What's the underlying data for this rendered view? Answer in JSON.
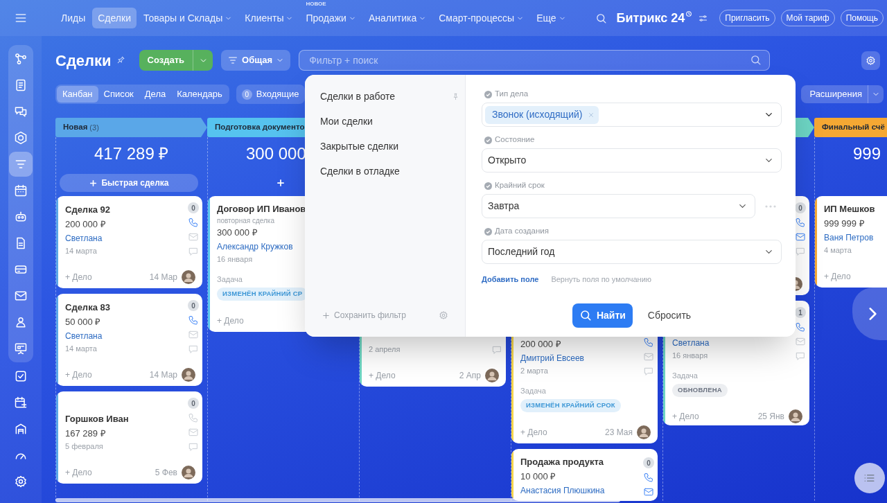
{
  "top_nav": {
    "items": [
      {
        "label": "Лиды",
        "selected": false,
        "dropdown": false
      },
      {
        "label": "Сделки",
        "selected": true,
        "dropdown": false
      },
      {
        "label": "Товары и Склады",
        "selected": false,
        "dropdown": true
      },
      {
        "label": "Клиенты",
        "selected": false,
        "dropdown": true
      },
      {
        "label": "Продажи",
        "selected": false,
        "dropdown": true,
        "badge": "НОВОЕ"
      },
      {
        "label": "Аналитика",
        "selected": false,
        "dropdown": true
      },
      {
        "label": "Смарт-процессы",
        "selected": false,
        "dropdown": true
      },
      {
        "label": "Еще",
        "selected": false,
        "dropdown": true
      }
    ],
    "logo": "Битрикс 24",
    "buttons": [
      "Пригласить",
      "Мой тариф",
      "Помощь"
    ]
  },
  "sidebar": {
    "panel_items": [
      {
        "selected": false
      },
      {
        "selected": false
      },
      {
        "selected": false
      },
      {
        "selected": false
      },
      {
        "selected": true
      },
      {
        "selected": false
      },
      {
        "selected": false
      },
      {
        "selected": false
      },
      {
        "selected": false
      },
      {
        "selected": false
      },
      {
        "selected": false
      },
      {
        "selected": false
      }
    ],
    "other_items": [
      {
        "selected": false
      },
      {
        "selected": false
      },
      {
        "selected": false
      },
      {
        "selected": false
      },
      {
        "selected": false
      }
    ]
  },
  "header": {
    "title": "Сделки",
    "create_button": "Создать",
    "category_button": "Общая",
    "search": {
      "placeholder": "Фильтр + поиск"
    }
  },
  "view_tabs": [
    {
      "label": "Канбан",
      "selected": true
    },
    {
      "label": "Список",
      "selected": false
    },
    {
      "label": "Дела",
      "selected": false
    },
    {
      "label": "Календарь",
      "selected": false
    }
  ],
  "incoming": {
    "count": "0",
    "label": "Входящие"
  },
  "extensions_button": "Расширения",
  "columns": [
    {
      "color": "#5aa7e8",
      "header": {
        "kind": "titled",
        "title": "Новая",
        "count": "(3)"
      },
      "amount": "417 289 ₽",
      "quick_add": {
        "kind": "wide",
        "label": "Быстрая сделка"
      },
      "cards": [
        {
          "title": "Сделка 92",
          "counter": "0",
          "amount": "200 000 ₽",
          "contact": "Светлана",
          "date": "14 марта",
          "icons": [
            {
              "kind": "phone",
              "active": true
            },
            {
              "kind": "mail",
              "active": false
            },
            {
              "kind": "chat",
              "active": false
            }
          ],
          "add_activity": "+ Дело",
          "due": "14 Мар",
          "avatar": true
        },
        {
          "title": "Сделка 83",
          "counter": "0",
          "amount": "50 000 ₽",
          "contact": "Светлана",
          "date": "14 марта",
          "icons": [
            {
              "kind": "phone",
              "active": true
            },
            {
              "kind": "mail",
              "active": false
            },
            {
              "kind": "chat",
              "active": false
            }
          ],
          "add_activity": "+ Дело",
          "due": "14 Мар",
          "avatar": true
        },
        {
          "title": "Горшков Иван",
          "counter": "0",
          "amount": "167 289 ₽",
          "date": "5 февраля",
          "icons": [
            {
              "kind": "phone",
              "active": false
            },
            {
              "kind": "mail",
              "active": false
            },
            {
              "kind": "chat",
              "active": false
            }
          ],
          "add_activity": "+ Дело",
          "due": "5 Фев",
          "avatar": true
        }
      ]
    },
    {
      "color": "#56c3ef",
      "header": {
        "kind": "titled",
        "title": "Подготовка документо"
      },
      "amount": "300 000",
      "quick_add": {
        "kind": "plus"
      },
      "cards": [
        {
          "title": "Договор ИП Иванов",
          "subtitle": "повторная сделка",
          "amount": "300 000 ₽",
          "contact": "Александр Кружков",
          "date": "16 января",
          "task": {
            "label": "Задача",
            "badge": "ИЗМЕНЁН КРАЙНИЙ СР",
            "kind": "changed"
          },
          "add_activity": "+ Дело"
        }
      ]
    },
    {
      "color": "#6dd5c4",
      "cards": [
        {
          "date": "2 апреля",
          "icons": [
            {
              "kind": "chat",
              "active": false
            }
          ],
          "add_activity": "+ Дело",
          "due": "2 Апр",
          "avatar": true
        }
      ]
    },
    {
      "color": "#f5d54a",
      "cards": [
        {
          "amount": "200 000 ₽",
          "contact": "Дмитрий Евсеев",
          "date": "2 марта",
          "icons": [
            {
              "kind": "phone",
              "active": true
            },
            {
              "kind": "mail",
              "active": false
            },
            {
              "kind": "chat",
              "active": false
            }
          ],
          "task": {
            "label": "Задача",
            "badge": "ИЗМЕНЁН КРАЙНИЙ СРОК",
            "kind": "changed"
          },
          "add_activity": "+ Дело",
          "due": "23 Мая",
          "avatar": true
        },
        {
          "title": "Продажа продукта",
          "counter": "0",
          "amount": "10 000 ₽",
          "contact": "Анастасия Плюшкина",
          "icons": [
            {
              "kind": "phone",
              "active": true
            },
            {
              "kind": "mail",
              "active": true
            }
          ]
        }
      ]
    },
    {
      "color": "#6dd5c4",
      "header": {
        "kind": "blank"
      },
      "cards": [
        {
          "counter": "0",
          "icons": [
            {
              "kind": "phone",
              "active": true
            },
            {
              "kind": "mail",
              "active": true
            },
            {
              "kind": "chat",
              "active": false
            }
          ],
          "avatar": true
        },
        {
          "counter": "1",
          "contact": "Светлана",
          "date": "16 января",
          "icons": [
            {
              "kind": "phone",
              "active": true
            },
            {
              "kind": "mail",
              "active": false
            },
            {
              "kind": "chat",
              "active": false
            }
          ],
          "task": {
            "label": "Задача",
            "badge": "ОБНОВЛЕНА",
            "kind": "updated"
          },
          "add_activity": "+ Дело",
          "due": "25 Янв",
          "avatar": true
        }
      ]
    },
    {
      "color": "#f5a833",
      "header": {
        "kind": "titled",
        "title": "Финальный счё"
      },
      "amount": "999",
      "cards": [
        {
          "title": "ИП Мешков",
          "amount": "999 999 ₽",
          "contact": "Ваня Петров",
          "date": "4 марта",
          "add_activity": "+ Дело"
        }
      ]
    }
  ],
  "filter_popup": {
    "presets": [
      {
        "label": "Сделки в работе",
        "pinned": true
      },
      {
        "label": "Мои сделки",
        "pinned": false
      },
      {
        "label": "Закрытые сделки",
        "pinned": false
      },
      {
        "label": "Сделки в отладке",
        "pinned": false
      }
    ],
    "save_filter": "Сохранить фильтр",
    "fields": [
      {
        "label": "Тип дела",
        "kind": "tags",
        "tags": [
          "Звонок (исходящий)"
        ]
      },
      {
        "label": "Состояние",
        "kind": "select",
        "value": "Открыто"
      },
      {
        "label": "Крайний срок",
        "kind": "select",
        "value": "Завтра",
        "more": true
      },
      {
        "label": "Дата создания",
        "kind": "select",
        "value": "Последний год"
      }
    ],
    "add_field": "Добавить поле",
    "restore_fields": "Вернуть поля по умолчанию",
    "find_button": "Найти",
    "reset_button": "Сбросить"
  }
}
